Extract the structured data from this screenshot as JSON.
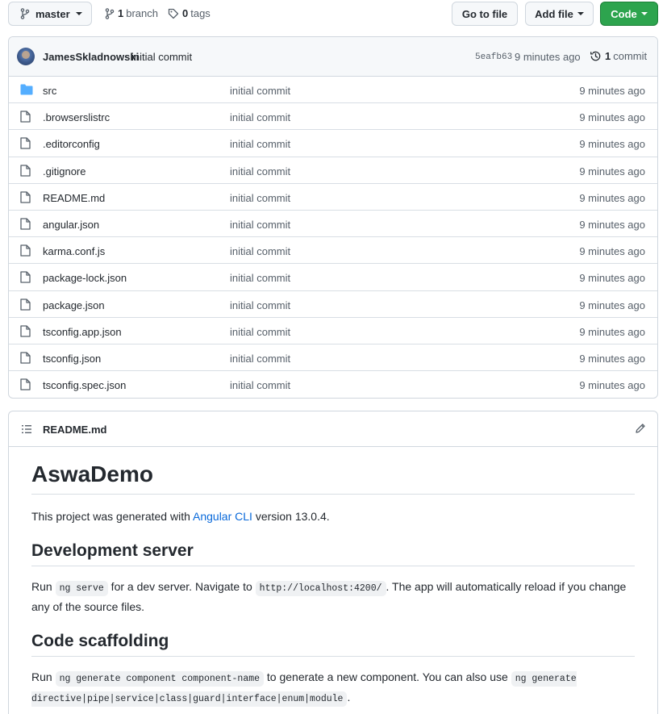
{
  "topbar": {
    "branch": "master",
    "branches_count": "1",
    "branches_label": "branch",
    "tags_count": "0",
    "tags_label": "tags",
    "goto_file": "Go to file",
    "add_file": "Add file",
    "code": "Code"
  },
  "latest_commit": {
    "author": "JamesSkladnowski",
    "message": "initial commit",
    "sha": "5eafb63",
    "time": "9 minutes ago",
    "commits_count": "1",
    "commits_label": "commit"
  },
  "files": [
    {
      "name": "src",
      "type": "folder",
      "message": "initial commit",
      "age": "9 minutes ago"
    },
    {
      "name": ".browserslistrc",
      "type": "file",
      "message": "initial commit",
      "age": "9 minutes ago"
    },
    {
      "name": ".editorconfig",
      "type": "file",
      "message": "initial commit",
      "age": "9 minutes ago"
    },
    {
      "name": ".gitignore",
      "type": "file",
      "message": "initial commit",
      "age": "9 minutes ago"
    },
    {
      "name": "README.md",
      "type": "file",
      "message": "initial commit",
      "age": "9 minutes ago"
    },
    {
      "name": "angular.json",
      "type": "file",
      "message": "initial commit",
      "age": "9 minutes ago"
    },
    {
      "name": "karma.conf.js",
      "type": "file",
      "message": "initial commit",
      "age": "9 minutes ago"
    },
    {
      "name": "package-lock.json",
      "type": "file",
      "message": "initial commit",
      "age": "9 minutes ago"
    },
    {
      "name": "package.json",
      "type": "file",
      "message": "initial commit",
      "age": "9 minutes ago"
    },
    {
      "name": "tsconfig.app.json",
      "type": "file",
      "message": "initial commit",
      "age": "9 minutes ago"
    },
    {
      "name": "tsconfig.json",
      "type": "file",
      "message": "initial commit",
      "age": "9 minutes ago"
    },
    {
      "name": "tsconfig.spec.json",
      "type": "file",
      "message": "initial commit",
      "age": "9 minutes ago"
    }
  ],
  "readme": {
    "filename": "README.md",
    "h1": "AswaDemo",
    "intro_before": "This project was generated with ",
    "intro_link": "Angular CLI",
    "intro_after": " version 13.0.4.",
    "dev_heading": "Development server",
    "dev_run": "Run ",
    "dev_code1": "ng serve",
    "dev_mid": " for a dev server. Navigate to ",
    "dev_code2": "http://localhost:4200/",
    "dev_after": ". The app will automatically reload if you change any of the source files.",
    "scaffold_heading": "Code scaffolding",
    "sc_run": "Run ",
    "sc_code1": "ng generate component component-name",
    "sc_mid": " to generate a new component. You can also use ",
    "sc_code2": "ng generate directive|pipe|service|class|guard|interface|enum|module",
    "sc_after": "."
  },
  "colors": {
    "primary_green": "#2da44e",
    "link_blue": "#0969da",
    "folder_blue": "#54aeff",
    "muted_text": "#57606a"
  }
}
